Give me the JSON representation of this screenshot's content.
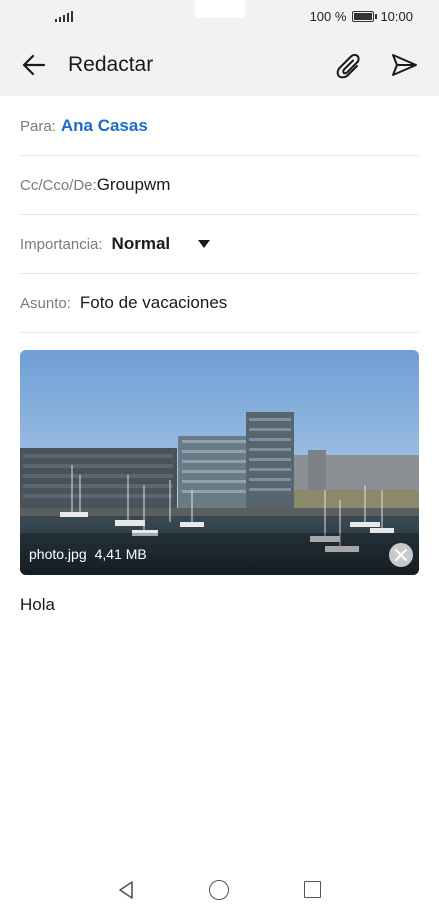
{
  "status_bar": {
    "battery_percent": "100 %",
    "time": "10:00",
    "signal_icon": "signal-icon",
    "battery_icon": "battery-icon"
  },
  "app_bar": {
    "title": "Redactar",
    "back_icon": "arrow-left-icon",
    "attach_icon": "paperclip-icon",
    "send_icon": "send-icon"
  },
  "compose": {
    "to_label": "Para:",
    "to_value": "Ana Casas",
    "cc_label": "Cc/Cco/De:",
    "cc_value": "Groupwm",
    "importance_label": "Importancia:",
    "importance_value": "Normal",
    "subject_label": "Asunto:",
    "subject_value": "Foto de vacaciones",
    "body": "Hola"
  },
  "attachment": {
    "filename": "photo.jpg",
    "size": "4,41 MB",
    "remove_icon": "close-icon"
  },
  "nav_bar": {
    "back_icon": "triangle-back-icon",
    "home_icon": "circle-home-icon",
    "recents_icon": "square-recents-icon"
  },
  "colors": {
    "accent": "#1a6dc4",
    "bar_bg": "#f2f2f2"
  }
}
